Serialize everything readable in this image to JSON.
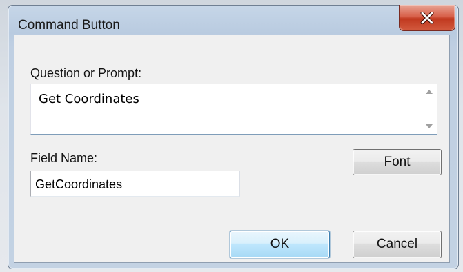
{
  "window": {
    "title": "Command Button"
  },
  "question": {
    "label": "Question or Prompt:",
    "value": "Get Coordinates"
  },
  "field": {
    "label": "Field Name:",
    "value": "GetCoordinates"
  },
  "buttons": {
    "font": "Font",
    "ok": "OK",
    "cancel": "Cancel"
  },
  "colors": {
    "close_button": "#c1391f",
    "title_bar": "#b9cbe0",
    "dialog_body": "#f0f0f0",
    "default_button": "#bee6fd"
  },
  "icons": {
    "close": "close-icon",
    "scroll_up": "scroll-up-arrow-icon",
    "scroll_down": "scroll-down-arrow-icon"
  }
}
